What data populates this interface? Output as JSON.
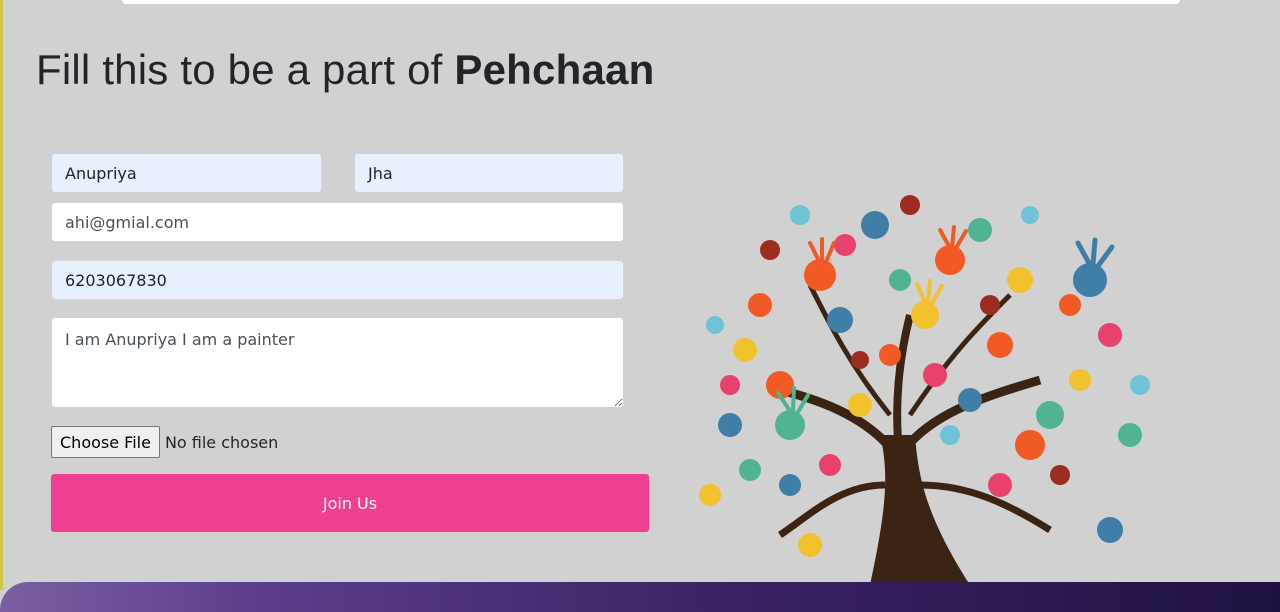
{
  "page": {
    "heading_prefix": "Fill this to be a part of ",
    "heading_brand": "Pehchaan"
  },
  "form": {
    "first_name": "Anupriya",
    "last_name": "Jha",
    "email": "ahi@gmial.com",
    "phone": "6203067830",
    "about": "I am Anupriya I am a painter",
    "file_button_label": "Choose File",
    "file_status": "No file chosen",
    "submit_label": "Join Us"
  },
  "colors": {
    "submit_button": "#ef3f90",
    "autofill_field": "#e8f0fe",
    "page_background": "#d1d1d1"
  },
  "illustration": {
    "icon": "handprint-tree-icon"
  }
}
